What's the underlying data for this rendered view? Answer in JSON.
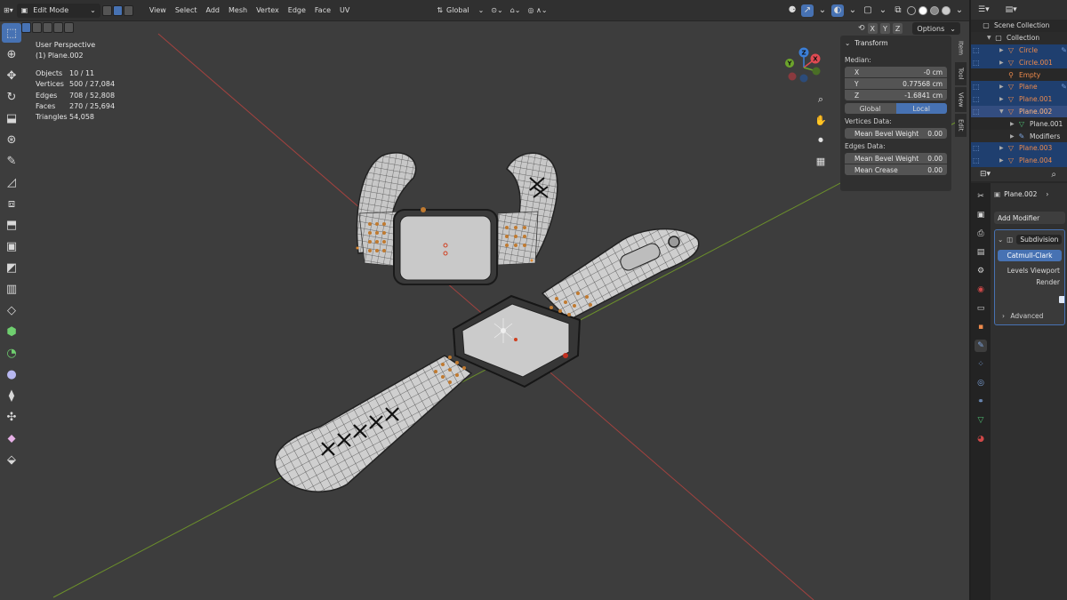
{
  "header": {
    "mode_label": "Edit Mode",
    "menus": [
      "View",
      "Select",
      "Add",
      "Mesh",
      "Vertex",
      "Edge",
      "Face",
      "UV"
    ],
    "orientation_label": "Global",
    "options_label": "Options",
    "axis_labels": [
      "X",
      "Y",
      "Z"
    ]
  },
  "viewport_info": {
    "perspective": "User Perspective",
    "object": "(1) Plane.002",
    "stats": [
      {
        "label": "Objects",
        "value": "10 / 11"
      },
      {
        "label": "Vertices",
        "value": "500 / 27,084"
      },
      {
        "label": "Edges",
        "value": "708 / 52,808"
      },
      {
        "label": "Faces",
        "value": "270 / 25,694"
      },
      {
        "label": "Triangles",
        "value": "54,058"
      }
    ]
  },
  "npanel": {
    "title": "Transform",
    "median_label": "Median:",
    "x_label": "X",
    "x_value": "-0 cm",
    "y_label": "Y",
    "y_value": "0.77568 cm",
    "z_label": "Z",
    "z_value": "-1.6841 cm",
    "global_label": "Global",
    "local_label": "Local",
    "vertices_data_label": "Vertices Data:",
    "mean_bevel_weight_label": "Mean Bevel Weight",
    "mean_bevel_weight_vertices": "0.00",
    "edges_data_label": "Edges Data:",
    "mean_bevel_weight_edges": "0.00",
    "mean_crease_label": "Mean Crease",
    "mean_crease_value": "0.00",
    "tabs": [
      "Item",
      "Tool",
      "View",
      "Edit"
    ]
  },
  "outliner": {
    "rows": [
      {
        "name": "Scene Collection",
        "type": "scene"
      },
      {
        "name": "Collection",
        "type": "collection"
      },
      {
        "name": "Circle",
        "type": "object"
      },
      {
        "name": "Circle.001",
        "type": "object"
      },
      {
        "name": "Empty",
        "type": "empty"
      },
      {
        "name": "Plane",
        "type": "object"
      },
      {
        "name": "Plane.001",
        "type": "object"
      },
      {
        "name": "Plane.002",
        "type": "object-selected"
      },
      {
        "name": "Plane.001",
        "type": "mesh"
      },
      {
        "name": "Modifiers",
        "type": "modifiers"
      },
      {
        "name": "Plane.003",
        "type": "object"
      },
      {
        "name": "Plane.004",
        "type": "object"
      }
    ]
  },
  "properties": {
    "object_name": "Plane.002",
    "add_modifier_label": "Add Modifier",
    "modifier_name": "Subdivision",
    "subdivision_type": "Catmull-Clark",
    "levels_viewport_label": "Levels Viewport",
    "render_label": "Render",
    "advanced_label": "Advanced"
  },
  "colors": {
    "accent": "#4772b3",
    "object_orange": "#ed8a4c",
    "x_axis": "#a3423f",
    "y_axis": "#6b8f2b",
    "gizmo_x": "#e04a52",
    "gizmo_y": "#6ca42c",
    "gizmo_z": "#3b7fd8"
  }
}
